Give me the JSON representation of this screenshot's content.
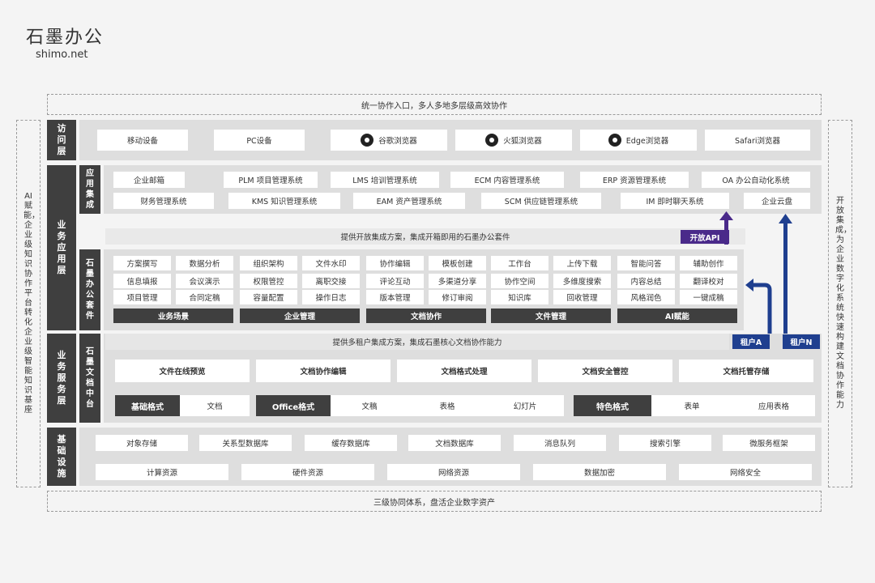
{
  "brand": {
    "name_cn": "石墨办公",
    "domain": "shimo.net"
  },
  "top_bar": "统一协作入口，多人多地多层级高效协作",
  "bottom_bar": "三级协同体系，盘活企业数字资产",
  "left_side": "AI赋能，企业级知识协作平台转化企业级智能知识基座",
  "right_side": "开放集成，为企业数字化系统快速构建文档协作能力",
  "access": {
    "label": "访问层",
    "items": [
      "移动设备",
      "PC设备",
      "谷歌浏览器",
      "火狐浏览器",
      "Edge浏览器",
      "Safari浏览器"
    ]
  },
  "business_app": {
    "label": "业务应用层",
    "integration": {
      "label": "应用集成",
      "row1": [
        "企业邮箱",
        "PLM 项目管理系统",
        "LMS 培训管理系统",
        "ECM 内容管理系统",
        "ERP 资源管理系统",
        "OA 办公自动化系统"
      ],
      "row2": [
        "财务管理系统",
        "KMS 知识管理系统",
        "EAM 资产管理系统",
        "SCM 供应链管理系统",
        "IM 即时聊天系统",
        "企业云盘"
      ]
    },
    "open_banner": "提供开放集成方案，集成开箱即用的石墨办公套件",
    "open_api": "开放API",
    "suite": {
      "label": "石墨办公套件",
      "groups": [
        {
          "title": "业务场景",
          "items": [
            "方案撰写",
            "数据分析",
            "信息填报",
            "会议演示",
            "项目管理",
            "合同定稿"
          ]
        },
        {
          "title": "企业管理",
          "items": [
            "组织架构",
            "文件水印",
            "权限管控",
            "离职交接",
            "容量配置",
            "操作日志"
          ]
        },
        {
          "title": "文档协作",
          "items": [
            "协作编辑",
            "模板创建",
            "评论互动",
            "多渠道分享",
            "版本管理",
            "修订审阅"
          ]
        },
        {
          "title": "文件管理",
          "items": [
            "工作台",
            "上传下载",
            "协作空间",
            "多维度搜索",
            "知识库",
            "回收管理"
          ]
        },
        {
          "title": "AI赋能",
          "items": [
            "智能问答",
            "辅助创作",
            "内容总结",
            "翻译校对",
            "风格润色",
            "一键成稿"
          ]
        }
      ]
    }
  },
  "business_service": {
    "label": "业务服务层",
    "sub_label": "石墨文档中台",
    "banner": "提供多租户集成方案，集成石墨核心文档协作能力",
    "tenant_a": "租户A",
    "tenant_n": "租户N",
    "capabilities": [
      "文件在线预览",
      "文档协作编辑",
      "文档格式处理",
      "文档安全管控",
      "文档托管存储"
    ],
    "formats": [
      {
        "tag": "基础格式",
        "items": [
          "文档"
        ]
      },
      {
        "tag": "Office格式",
        "items": [
          "文稿",
          "表格",
          "幻灯片"
        ]
      },
      {
        "tag": "特色格式",
        "items": [
          "表单",
          "应用表格"
        ]
      }
    ]
  },
  "infra": {
    "label": "基础设施",
    "row1": [
      "对象存储",
      "关系型数据库",
      "缓存数据库",
      "文档数据库",
      "消息队列",
      "搜索引擎",
      "微服务框架"
    ],
    "row2": [
      "计算资源",
      "硬件资源",
      "网络资源",
      "数据加密",
      "网络安全"
    ]
  },
  "colors": {
    "dark": "#3f3f3f",
    "purple": "#4a2a8a",
    "blue": "#1f3f8f",
    "panel": "#dedede"
  }
}
